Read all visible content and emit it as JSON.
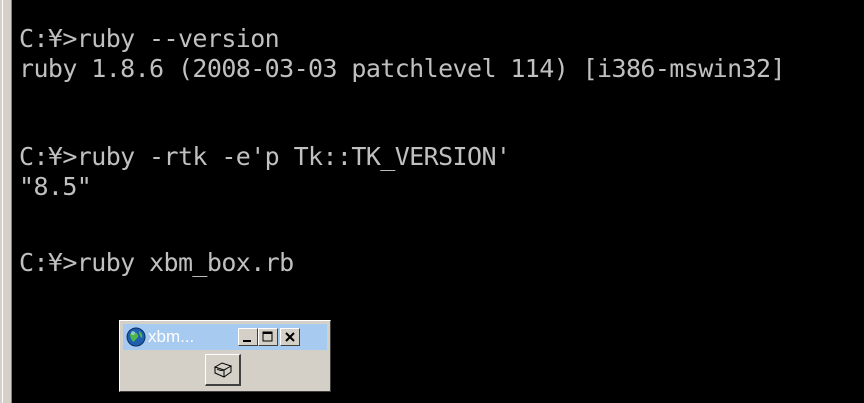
{
  "console": {
    "lines": [
      "C:¥>ruby --version",
      "ruby 1.8.6 (2008-03-03 patchlevel 114) [i386-mswin32]",
      "",
      "C:¥>ruby -rtk -e'p Tk::TK_VERSION'",
      "\"8.5\"",
      "",
      "C:¥>ruby xbm_box.rb"
    ]
  },
  "tk_window": {
    "title": "xbm...",
    "icon": "ruby-globe-icon",
    "buttons": [
      "minimize-icon",
      "maximize-icon",
      "close-icon"
    ],
    "bitmap_button_icon": "box-bitmap-icon"
  },
  "colors": {
    "console_bg": "#000000",
    "console_text": "#c0c0c0",
    "window_face": "#d4d0c8",
    "titlebar_inactive": "#a6caf0"
  }
}
